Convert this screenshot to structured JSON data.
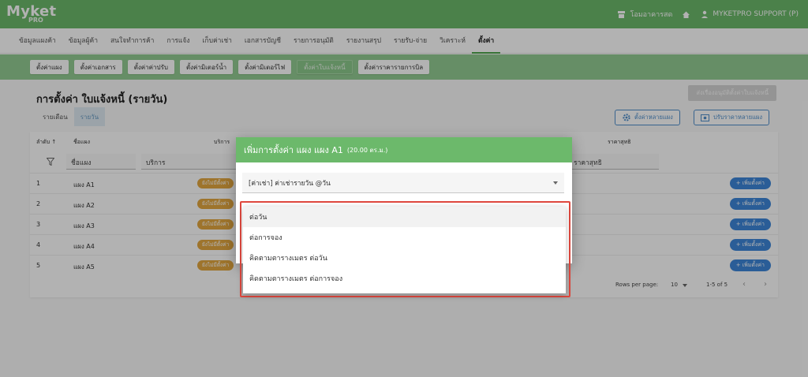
{
  "app": {
    "logo_main": "Myket",
    "logo_sub": "PRO",
    "shop_label": "โอมอาคารสด",
    "user_label": "MYKETPRO SUPPORT (P)"
  },
  "main_nav": [
    "ข้อมูลแผงค้า",
    "ข้อมูลผู้ค้า",
    "สนใจทำการค้า",
    "การแจ้ง",
    "เก็บค่าเช่า",
    "เอกสารบัญชี",
    "รายการอนุมัติ",
    "รายงานสรุป",
    "รายรับ-จ่าย",
    "วิเคราะห์",
    "ตั้งค่า"
  ],
  "sub_nav": [
    "ตั้งค่าแผง",
    "ตั้งค่าเอกสาร",
    "ตั้งค่าค่าปรับ",
    "ตั้งค่ามิเตอร์น้ำ",
    "ตั้งค่ามิเตอร์ไฟ",
    "ตั้งค่าใบแจ้งหนี้",
    "ตั้งค่าราคารายการบิล"
  ],
  "page": {
    "title": "การตั้งค่า ใบแจ้งหนี้ (รายวัน)",
    "mode_tabs": [
      "รายเดือน",
      "รายวัน"
    ],
    "disabled_button": "ส่งเรื่องอนุมัติตั้งค่าใบแจ้งหนี้",
    "setup_multi_button": "ตั้งค่าหลายแผง",
    "adjust_price_button": "ปรับราคาหลายแผง"
  },
  "table": {
    "headers": {
      "order": "ลำดับ ↑",
      "name": "ชื่อแผง",
      "service": "บริการ",
      "net": "ราคาสุทธิ"
    },
    "filters": {
      "name": "ชื่อแผง",
      "service": "บริการ",
      "net": "ราคาสุทธิ"
    },
    "rows": [
      {
        "no": "1",
        "name": "แผง A1",
        "chip": "ยังไม่มีตั้งค่า"
      },
      {
        "no": "2",
        "name": "แผง A2",
        "chip": "ยังไม่มีตั้งค่า"
      },
      {
        "no": "3",
        "name": "แผง A3",
        "chip": "ยังไม่มีตั้งค่า"
      },
      {
        "no": "4",
        "name": "แผง A4",
        "chip": "ยังไม่มีตั้งค่า"
      },
      {
        "no": "5",
        "name": "แผง A5",
        "chip": "ยังไม่มีตั้งค่า"
      }
    ],
    "add_label": "+ เพิ่มตั้งค่า",
    "rows_per_page_label": "Rows per page:",
    "rows_per_page_value": "10",
    "range_label": "1-5 of 5"
  },
  "dialog": {
    "title": "เพิ่มการตั้งค่า แผง แผง A1",
    "title_small": "(20.00 ตร.ม.)",
    "select_value": "[ค่าเช่า] ค่าเช่ารายวัน @วัน"
  },
  "dropdown": {
    "options": [
      "ต่อวัน",
      "ต่อการจอง",
      "คิดตามตารางเมตร ต่อวัน",
      "คิดตามตารางเมตร ต่อการจอง"
    ]
  },
  "colors": {
    "brand_green": "#6cb96b",
    "sub_nav_green": "#93cc92",
    "accent_blue": "#3d86d9",
    "chip_orange": "#e2a740",
    "highlight_red": "#e0483e"
  }
}
